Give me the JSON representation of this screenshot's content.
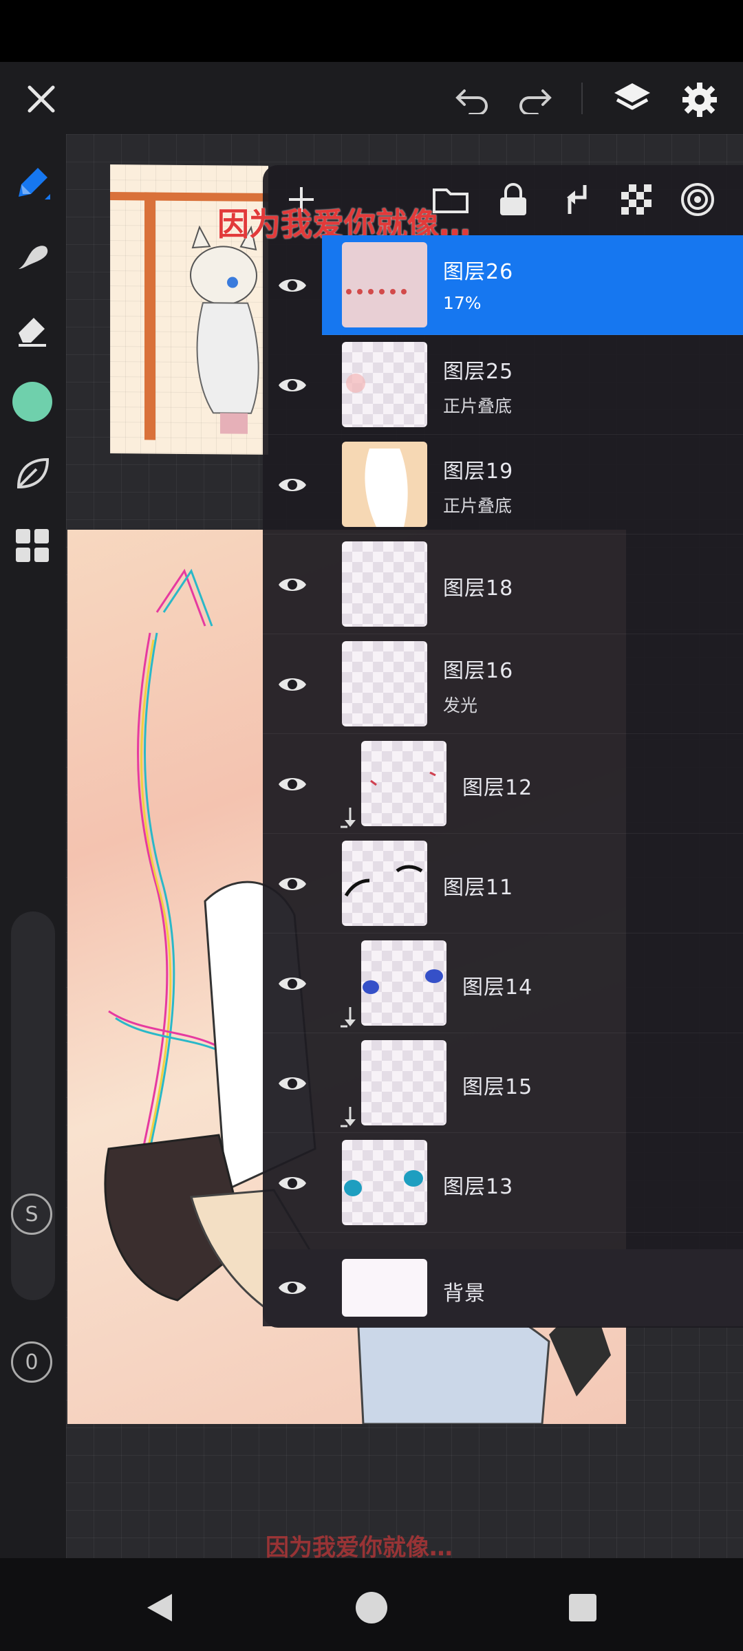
{
  "watermark_top": "因为我爱你就像…",
  "watermark_bottom": "因为我爱你就像…",
  "topbar": {
    "icons": [
      "close-icon",
      "undo-icon",
      "redo-icon",
      "layers-icon",
      "settings-icon"
    ]
  },
  "leftbar": {
    "tools": [
      "brush-icon",
      "smudge-icon",
      "eraser-icon",
      "color-swatch",
      "leaf-icon",
      "apps-icon"
    ],
    "color": "#6fd0ac",
    "size_label": "S",
    "opacity_label": "0"
  },
  "panel_tools": [
    "add-layer-icon",
    "folder-icon",
    "lock-icon",
    "merge-down-icon",
    "checker-icon",
    "target-icon"
  ],
  "layers": [
    {
      "name": "图层26",
      "mode": "17%",
      "selected": true
    },
    {
      "name": "图层25",
      "mode": "正片叠底",
      "selected": false
    },
    {
      "name": "图层19",
      "mode": "正片叠底",
      "selected": false
    },
    {
      "name": "图层18",
      "mode": "",
      "selected": false
    },
    {
      "name": "图层16",
      "mode": "发光",
      "selected": false
    },
    {
      "name": "图层12",
      "mode": "",
      "selected": false,
      "clipped": true
    },
    {
      "name": "图层11",
      "mode": "",
      "selected": false
    },
    {
      "name": "图层14",
      "mode": "",
      "selected": false,
      "clipped": true
    },
    {
      "name": "图层15",
      "mode": "",
      "selected": false,
      "clipped": true
    },
    {
      "name": "图层13",
      "mode": "",
      "selected": false
    },
    {
      "name": "背景",
      "mode": "",
      "selected": false
    }
  ],
  "colors": {
    "accent": "#1677f0",
    "watermark": "#e23a3a"
  },
  "navbar": [
    "back-icon",
    "home-icon",
    "recents-icon"
  ]
}
